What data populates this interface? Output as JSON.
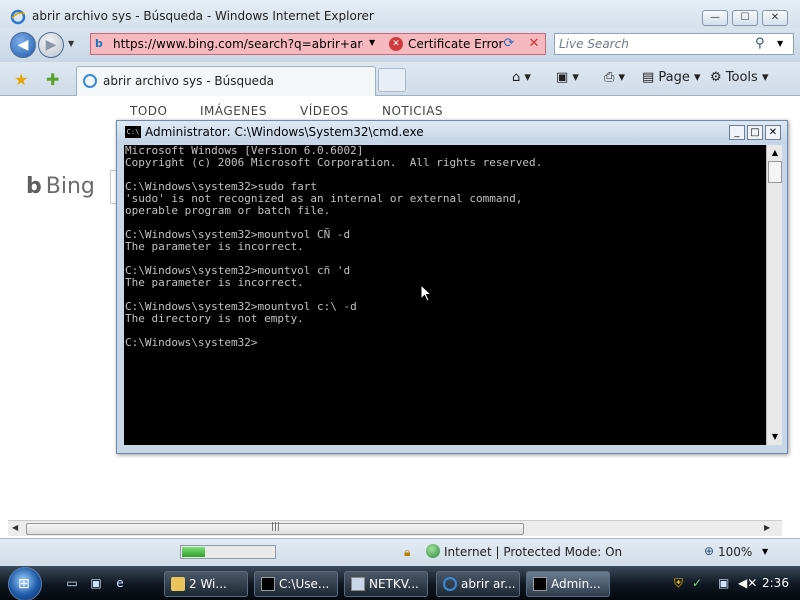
{
  "ie": {
    "window_title": "abrir archivo sys - Búsqueda - Windows Internet Explorer",
    "caption_buttons": {
      "minimize": "—",
      "maximize": "☐",
      "close": "✕"
    },
    "address_url": "https://www.bing.com/search?q=abrir+archivc",
    "cert_error_label": "Certificate Error",
    "search_placeholder": "Live Search",
    "tab_label": "abrir archivo sys - Búsqueda",
    "toolbar": {
      "page_label": "Page",
      "tools_label": "Tools"
    }
  },
  "bing": {
    "logo_text": "Bing",
    "tabs": [
      "TODO",
      "IMÁGENES",
      "VÍDEOS",
      "NOTICIAS"
    ]
  },
  "cmd": {
    "title": "Administrator: C:\\Windows\\System32\\cmd.exe",
    "icon_text": "C:\\",
    "lines": [
      "Microsoft Windows [Version 6.0.6002]",
      "Copyright (c) 2006 Microsoft Corporation.  All rights reserved.",
      "",
      "C:\\Windows\\system32>sudo fart",
      "'sudo' is not recognized as an internal or external command,",
      "operable program or batch file.",
      "",
      "C:\\Windows\\system32>mountvol CÑ -d",
      "The parameter is incorrect.",
      "",
      "C:\\Windows\\system32>mountvol cñ 'd",
      "The parameter is incorrect.",
      "",
      "C:\\Windows\\system32>mountvol c:\\ -d",
      "The directory is not empty.",
      "",
      "C:\\Windows\\system32>"
    ]
  },
  "status": {
    "progress_fraction": 0.25,
    "zone_text": "Internet | Protected Mode: On",
    "zoom_text": "100%"
  },
  "taskbar": {
    "tasks": [
      {
        "label": "2 Wi...",
        "icon": "folder-icon"
      },
      {
        "label": "C:\\Use...",
        "icon": "cmd-icon"
      },
      {
        "label": "NETKV...",
        "icon": "window-icon"
      },
      {
        "label": "abrir ar...",
        "icon": "ie-icon"
      },
      {
        "label": "Admin...",
        "icon": "cmd-icon"
      }
    ],
    "clock": "2:36"
  }
}
